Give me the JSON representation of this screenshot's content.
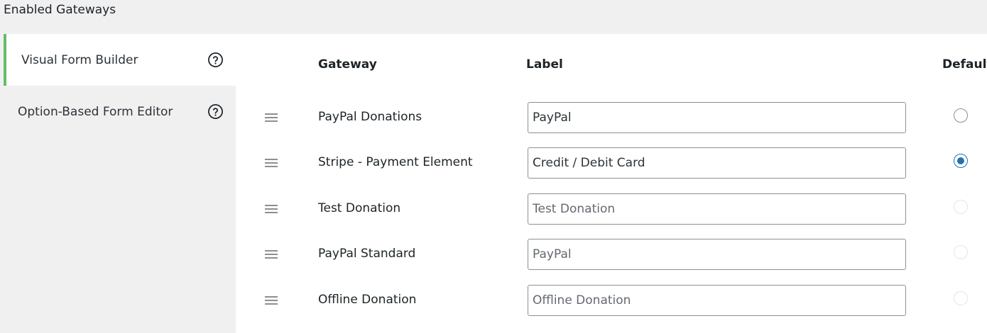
{
  "section": {
    "title": "Enabled Gateways"
  },
  "tabs": [
    {
      "label": "Visual Form Builder",
      "active": true,
      "icon": "help-circle-icon"
    },
    {
      "label": "Option-Based Form Editor",
      "active": false,
      "icon": "help-circle-icon"
    }
  ],
  "table": {
    "headers": {
      "gateway": "Gateway",
      "label": "Label",
      "default": "Default"
    },
    "rows": [
      {
        "gateway": "PayPal Donations",
        "label_value": "PayPal",
        "label_placeholder": "",
        "default_state": "unchecked"
      },
      {
        "gateway": "Stripe - Payment Element",
        "label_value": "Credit / Debit Card",
        "label_placeholder": "",
        "default_state": "checked"
      },
      {
        "gateway": "Test Donation",
        "label_value": "",
        "label_placeholder": "Test Donation",
        "default_state": "disabled"
      },
      {
        "gateway": "PayPal Standard",
        "label_value": "",
        "label_placeholder": "PayPal",
        "default_state": "disabled"
      },
      {
        "gateway": "Offline Donation",
        "label_value": "",
        "label_placeholder": "Offline Donation",
        "default_state": "disabled"
      }
    ]
  },
  "colors": {
    "active_tab_accent": "#66bb6a",
    "radio_checked": "#2271b1",
    "page_background": "#f0f0f1"
  }
}
